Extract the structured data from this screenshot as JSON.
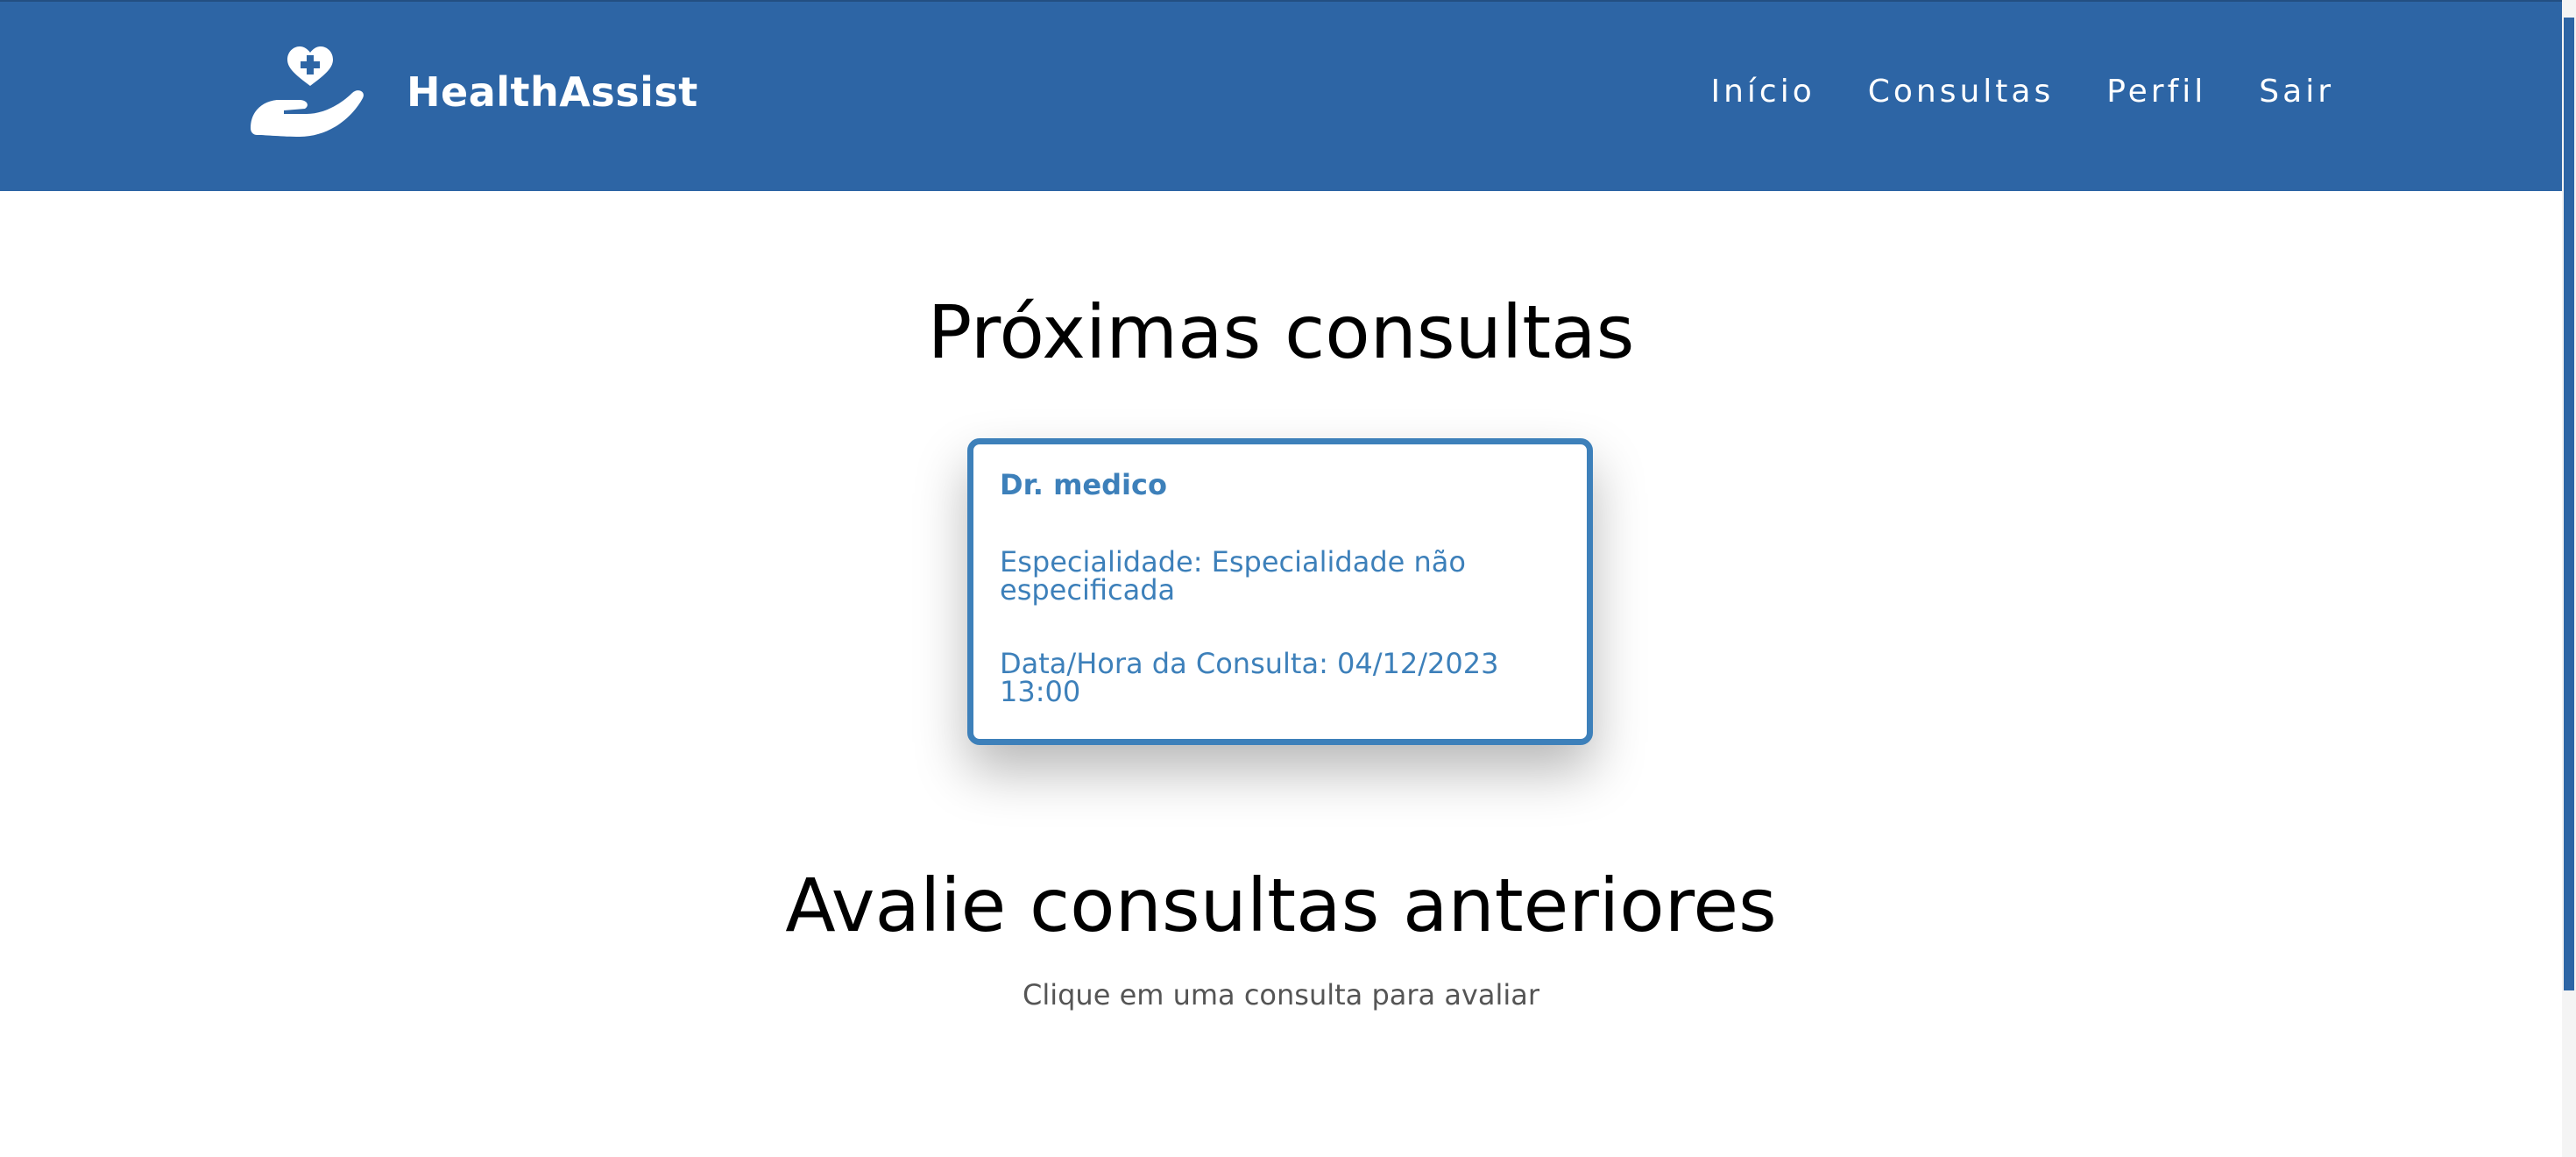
{
  "app": {
    "name": "HealthAssist"
  },
  "colors": {
    "primary": "#2d65a5",
    "card_accent": "#3d80ba",
    "text_muted": "#555555"
  },
  "icons": {
    "logo": "hand-heart-cross-icon"
  },
  "nav": {
    "items": [
      {
        "label": "Início"
      },
      {
        "label": "Consultas"
      },
      {
        "label": "Perfil"
      },
      {
        "label": "Sair"
      }
    ]
  },
  "upcoming": {
    "title": "Próximas consultas",
    "appointments": [
      {
        "doctor": "Dr. medico",
        "specialty": "Especialidade: Especialidade não especificada",
        "datetime": "Data/Hora da Consulta: 04/12/2023 13:00"
      }
    ]
  },
  "past": {
    "title": "Avalie consultas anteriores",
    "hint": "Clique em uma consulta para avaliar"
  }
}
